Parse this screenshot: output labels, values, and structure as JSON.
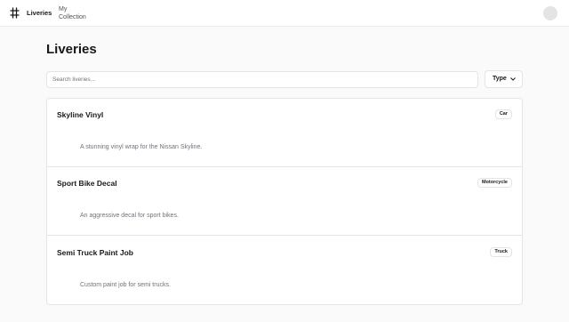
{
  "nav": {
    "brand_icon": "hash-icon",
    "liveries_label": "Liveries",
    "my_collection_label": "My Collection"
  },
  "page": {
    "title": "Liveries"
  },
  "search": {
    "placeholder": "Search liveries...",
    "value": ""
  },
  "filter": {
    "type_label": "Type",
    "icon": "chevron-down-icon"
  },
  "liveries": [
    {
      "title": "Skyline Vinyl",
      "type": "Car",
      "description": "A stunning vinyl wrap for the Nissan Skyline."
    },
    {
      "title": "Sport Bike Decal",
      "type": "Motorcycle",
      "description": "An aggressive decal for sport bikes."
    },
    {
      "title": "Semi Truck Paint Job",
      "type": "Truck",
      "description": "Custom paint job for semi trucks."
    }
  ],
  "colors": {
    "background": "#fafafa",
    "surface": "#ffffff",
    "border": "#e4e4e7",
    "text": "#18181b",
    "muted_text": "#71717a"
  }
}
